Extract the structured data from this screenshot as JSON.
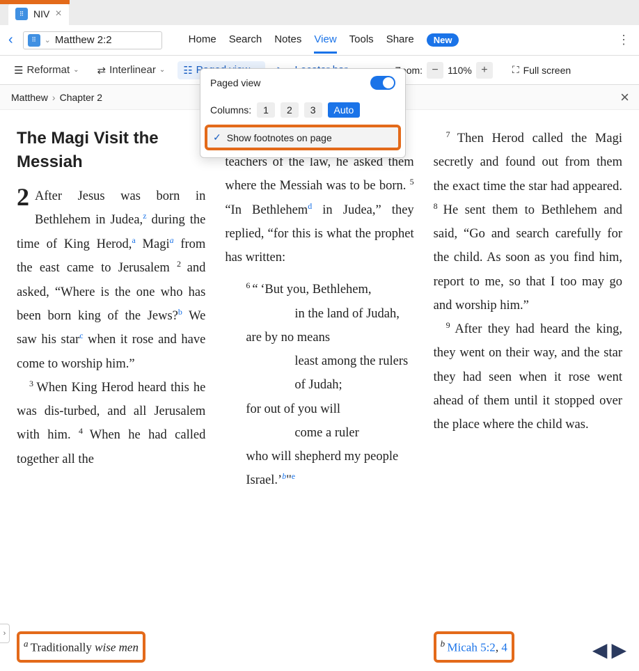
{
  "tab": {
    "label": "NIV"
  },
  "nav": {
    "reference": "Matthew 2:2",
    "links": [
      "Home",
      "Search",
      "Notes",
      "View",
      "Tools",
      "Share"
    ],
    "active": "View",
    "new_label": "New"
  },
  "toolbar": {
    "reformat": "Reformat",
    "interlinear": "Interlinear",
    "paged": "Paged view",
    "locator": "Locator bar",
    "zoom_label": "Zoom:",
    "zoom_value": "110%",
    "fullscreen": "Full screen"
  },
  "breadcrumb": {
    "book": "Matthew",
    "chapter": "Chapter 2"
  },
  "dropdown": {
    "title": "Paged view",
    "columns_label": "Columns:",
    "cols": [
      "1",
      "2",
      "3"
    ],
    "auto": "Auto",
    "footnotes": "Show footnotes on page"
  },
  "text": {
    "heading": "The Magi Visit the Messiah",
    "ch": "2",
    "v2a": "After Jesus was born in Bethlehem in Judea,",
    "v2b": " during the time of King Herod,",
    "v2c": " Magi",
    "v2d": " from the east came to Jerusalem ",
    "v2e": "and asked, “Where is the one who has been born king of the Jews?",
    "v2f": " We saw his star",
    "v2g": " when it rose and have come to worship him.”",
    "v3": "When King Herod heard this he was dis-turbed, and all Jerusalem with him. ",
    "v4a": "When he had called together all the",
    "c2_top": "teachers of the law, he asked them where the Messiah was to be born. ",
    "v5a": "“In Bethlehem",
    "v5b": " in Judea,” they replied, “for this is what the prophet has written:",
    "v6a": "“ ‘But you, Bethlehem,",
    "v6b": "in the land of Judah,",
    "v6c": "are by no means",
    "v6d": "least among the rulers of Judah;",
    "v6e": "for out of you will",
    "v6f": "come a ruler",
    "v6g": "who will shepherd my people Israel.’",
    "v7": "Then Herod called the Magi secretly and found out from them the exact time the star had appeared. ",
    "v8": "He sent them to Bethlehem and said, “Go and search carefully for the child. As soon as you find him, report to me, so that I too may go and worship him.”",
    "v9": "After they had heard the king, they went on their way, and the star they had seen when it rose went ahead of them until it stopped over the place where the child was."
  },
  "footnotes": {
    "a_text": "Traditionally ",
    "a_em": "wise men",
    "b_ref1": "Micah 5:2",
    "b_comma": ", ",
    "b_ref2": "4"
  }
}
